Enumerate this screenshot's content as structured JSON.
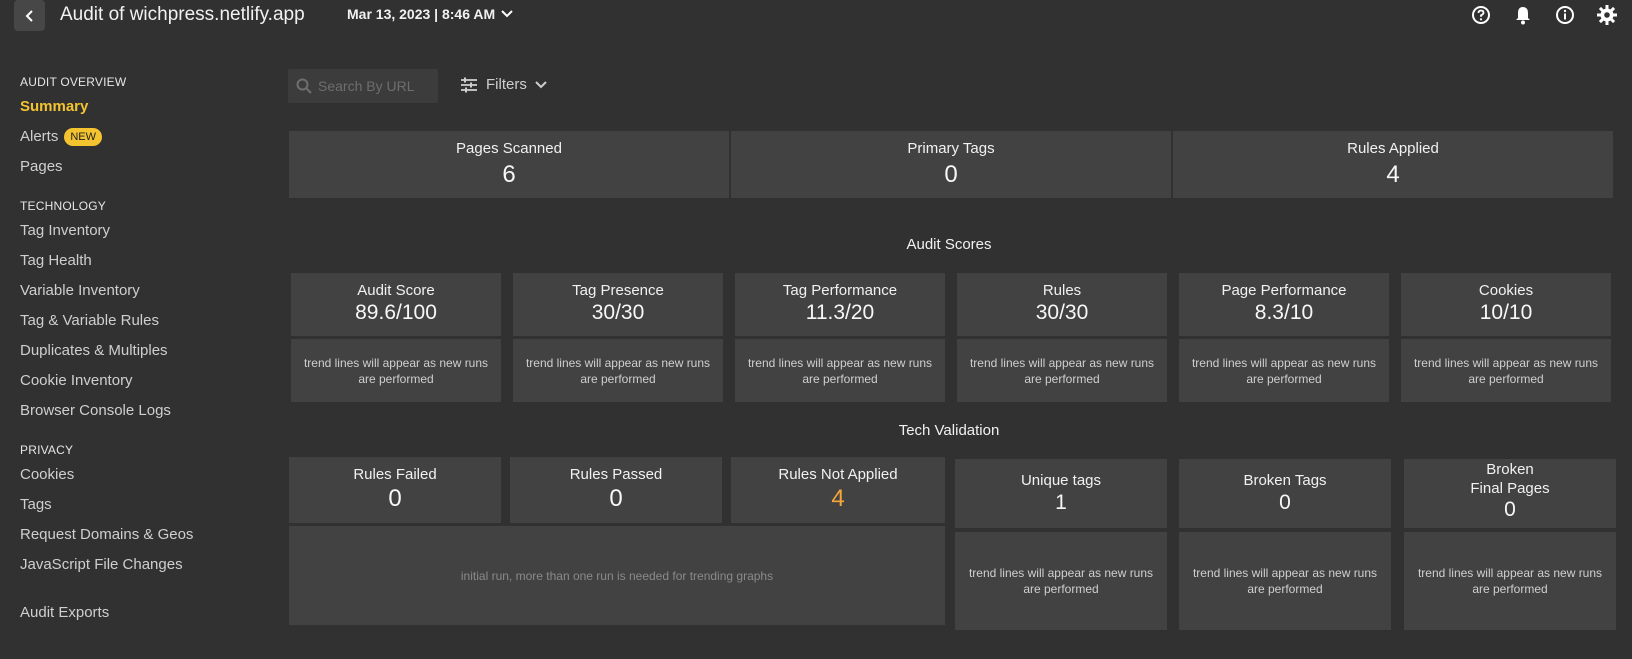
{
  "header": {
    "title": "Audit of wichpress.netlify.app",
    "date": "Mar 13, 2023 | 8:46 AM"
  },
  "sidebar": {
    "sections": [
      {
        "heading": "AUDIT OVERVIEW"
      },
      {
        "heading": "TECHNOLOGY"
      },
      {
        "heading": "PRIVACY"
      }
    ],
    "audit_overview": [
      "Summary",
      "Alerts",
      "Pages"
    ],
    "alerts_badge": "NEW",
    "technology": [
      "Tag Inventory",
      "Tag Health",
      "Variable Inventory",
      "Tag & Variable Rules",
      "Duplicates & Multiples",
      "Cookie Inventory",
      "Browser Console Logs"
    ],
    "privacy": [
      "Cookies",
      "Tags",
      "Request Domains & Geos",
      "JavaScript File Changes"
    ],
    "audit_exports": "Audit Exports"
  },
  "toolbar": {
    "search_placeholder": "Search By URL",
    "filters_label": "Filters"
  },
  "stats": [
    {
      "label": "Pages Scanned",
      "value": "6"
    },
    {
      "label": "Primary Tags",
      "value": "0"
    },
    {
      "label": "Rules Applied",
      "value": "4"
    }
  ],
  "audit_scores": {
    "title": "Audit Scores",
    "items": [
      {
        "label": "Audit Score",
        "value": "89.6/100"
      },
      {
        "label": "Tag Presence",
        "value": "30/30"
      },
      {
        "label": "Tag Performance",
        "value": "11.3/20"
      },
      {
        "label": "Rules",
        "value": "30/30"
      },
      {
        "label": "Page Performance",
        "value": "8.3/10"
      },
      {
        "label": "Cookies",
        "value": "10/10"
      }
    ],
    "trend_text": "trend lines will appear as new runs are performed"
  },
  "tech_validation": {
    "title": "Tech Validation",
    "rules": [
      {
        "label": "Rules Failed",
        "value": "0"
      },
      {
        "label": "Rules Passed",
        "value": "0"
      },
      {
        "label": "Rules Not Applied",
        "value": "4"
      }
    ],
    "rules_trend_text": "initial run, more than one run is needed for trending graphs",
    "tags": [
      {
        "label": "Unique tags",
        "value": "1"
      },
      {
        "label": "Broken Tags",
        "value": "0"
      },
      {
        "label": "Broken Final Pages",
        "value": "0"
      }
    ],
    "trend_text": "trend lines will appear as new runs are performed"
  },
  "colors": {
    "accent": "#f4c430",
    "warning": "#f4a63b"
  }
}
